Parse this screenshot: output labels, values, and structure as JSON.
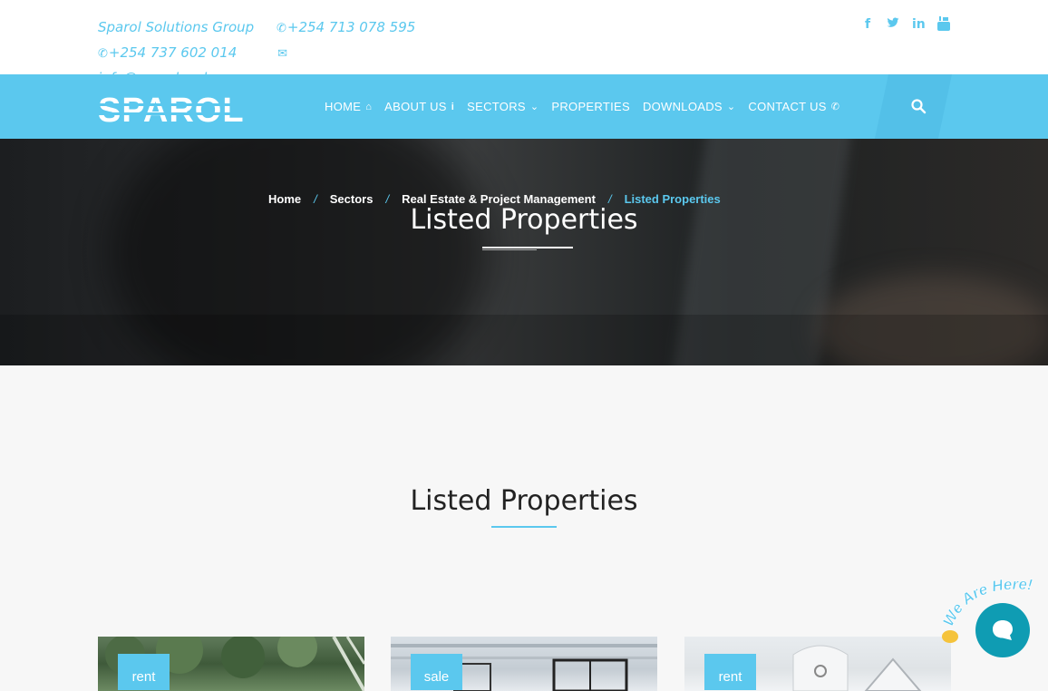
{
  "topbar": {
    "company": "Sparol Solutions Group",
    "phone1": "+254 713 078 595",
    "phone2": "+254 737 602 014",
    "email": "info@sparol.co.ke",
    "social": [
      "facebook-icon",
      "twitter-icon",
      "linkedin-icon",
      "youtube-icon"
    ]
  },
  "brand": {
    "logo_text": "SPAROL",
    "accent": "#5bc8ee"
  },
  "nav": {
    "items": [
      {
        "label": "HOME",
        "icon": "home-icon"
      },
      {
        "label": "ABOUT US",
        "icon": "info-icon"
      },
      {
        "label": "SECTORS",
        "icon": "chevron-down-icon"
      },
      {
        "label": "PROPERTIES",
        "icon": ""
      },
      {
        "label": "DOWNLOADS",
        "icon": "chevron-down-icon"
      },
      {
        "label": "CONTACT US",
        "icon": "phone-icon"
      }
    ],
    "search_icon": "search-icon"
  },
  "hero": {
    "title": "Listed Properties",
    "breadcrumb": [
      {
        "label": "Home"
      },
      {
        "label": "Sectors"
      },
      {
        "label": "Real Estate & Project Management"
      },
      {
        "label": "Listed Properties"
      }
    ],
    "separator": "/"
  },
  "section": {
    "title": "Listed Properties"
  },
  "cards": [
    {
      "badge": "rent"
    },
    {
      "badge": "sale"
    },
    {
      "badge": "rent"
    }
  ],
  "chat": {
    "banner": "We Are Here!"
  }
}
